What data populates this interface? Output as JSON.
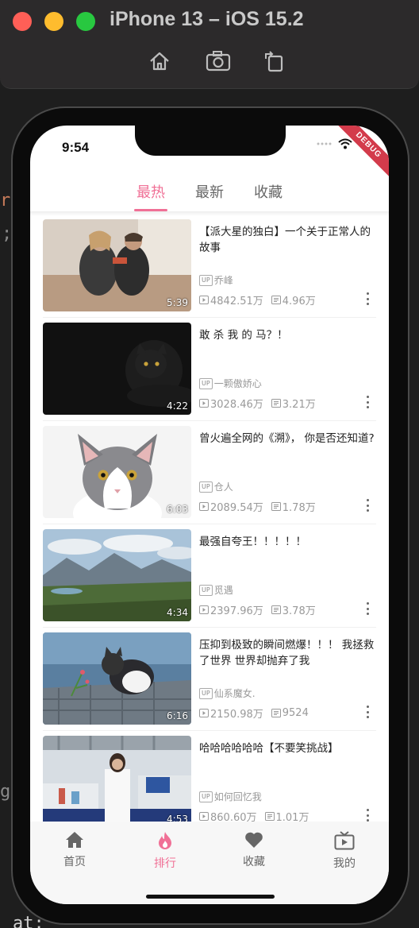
{
  "simulator": {
    "title": "iPhone 13 – iOS 15.2",
    "tools": [
      "home-icon",
      "screenshot-icon",
      "rotate-icon"
    ],
    "colors": {
      "close": "#ff5f57",
      "minimize": "#febc2e",
      "zoom": "#28c840"
    }
  },
  "background": {
    "fragments": [
      "r",
      ";",
      "g",
      "at:"
    ]
  },
  "status_bar": {
    "time": "9:54",
    "debug_label": "DEBUG"
  },
  "top_tabs": [
    {
      "label": "最热",
      "active": true
    },
    {
      "label": "最新",
      "active": false
    },
    {
      "label": "收藏",
      "active": false
    }
  ],
  "videos": [
    {
      "title": "【派大星的独白】一个关于正常人的故事",
      "up_badge": "UP",
      "uploader": "乔峰",
      "views": "4842.51万",
      "danmaku": "4.96万",
      "duration": "5:39"
    },
    {
      "title": "敢 杀 我 的 马？！",
      "up_badge": "UP",
      "uploader": "一颗傲娇心",
      "views": "3028.46万",
      "danmaku": "3.21万",
      "duration": "4:22"
    },
    {
      "title": "曾火遍全网的《溯》， 你是否还知道?",
      "up_badge": "UP",
      "uploader": "仓人",
      "views": "2089.54万",
      "danmaku": "1.78万",
      "duration": "6:03"
    },
    {
      "title": "最强自夸王！！！！！",
      "up_badge": "UP",
      "uploader": "觅遇",
      "views": "2397.96万",
      "danmaku": "3.78万",
      "duration": "4:34"
    },
    {
      "title": "压抑到极致的瞬间燃爆！！！ 我拯救了世界 世界却抛弃了我",
      "up_badge": "UP",
      "uploader": "仙系魔女.",
      "views": "2150.98万",
      "danmaku": "9524",
      "duration": "6:16"
    },
    {
      "title": "哈哈哈哈哈哈【不要笑挑战】",
      "up_badge": "UP",
      "uploader": "如何回忆我",
      "views": "860.60万",
      "danmaku": "1.01万",
      "duration": "4:53"
    }
  ],
  "bottom_nav": [
    {
      "label": "首页",
      "icon": "home-icon",
      "active": false
    },
    {
      "label": "排行",
      "icon": "flame-icon",
      "active": true
    },
    {
      "label": "收藏",
      "icon": "heart-icon",
      "active": false
    },
    {
      "label": "我的",
      "icon": "tv-icon",
      "active": false
    }
  ],
  "colors": {
    "accent": "#f07096",
    "text_secondary": "#999999"
  }
}
